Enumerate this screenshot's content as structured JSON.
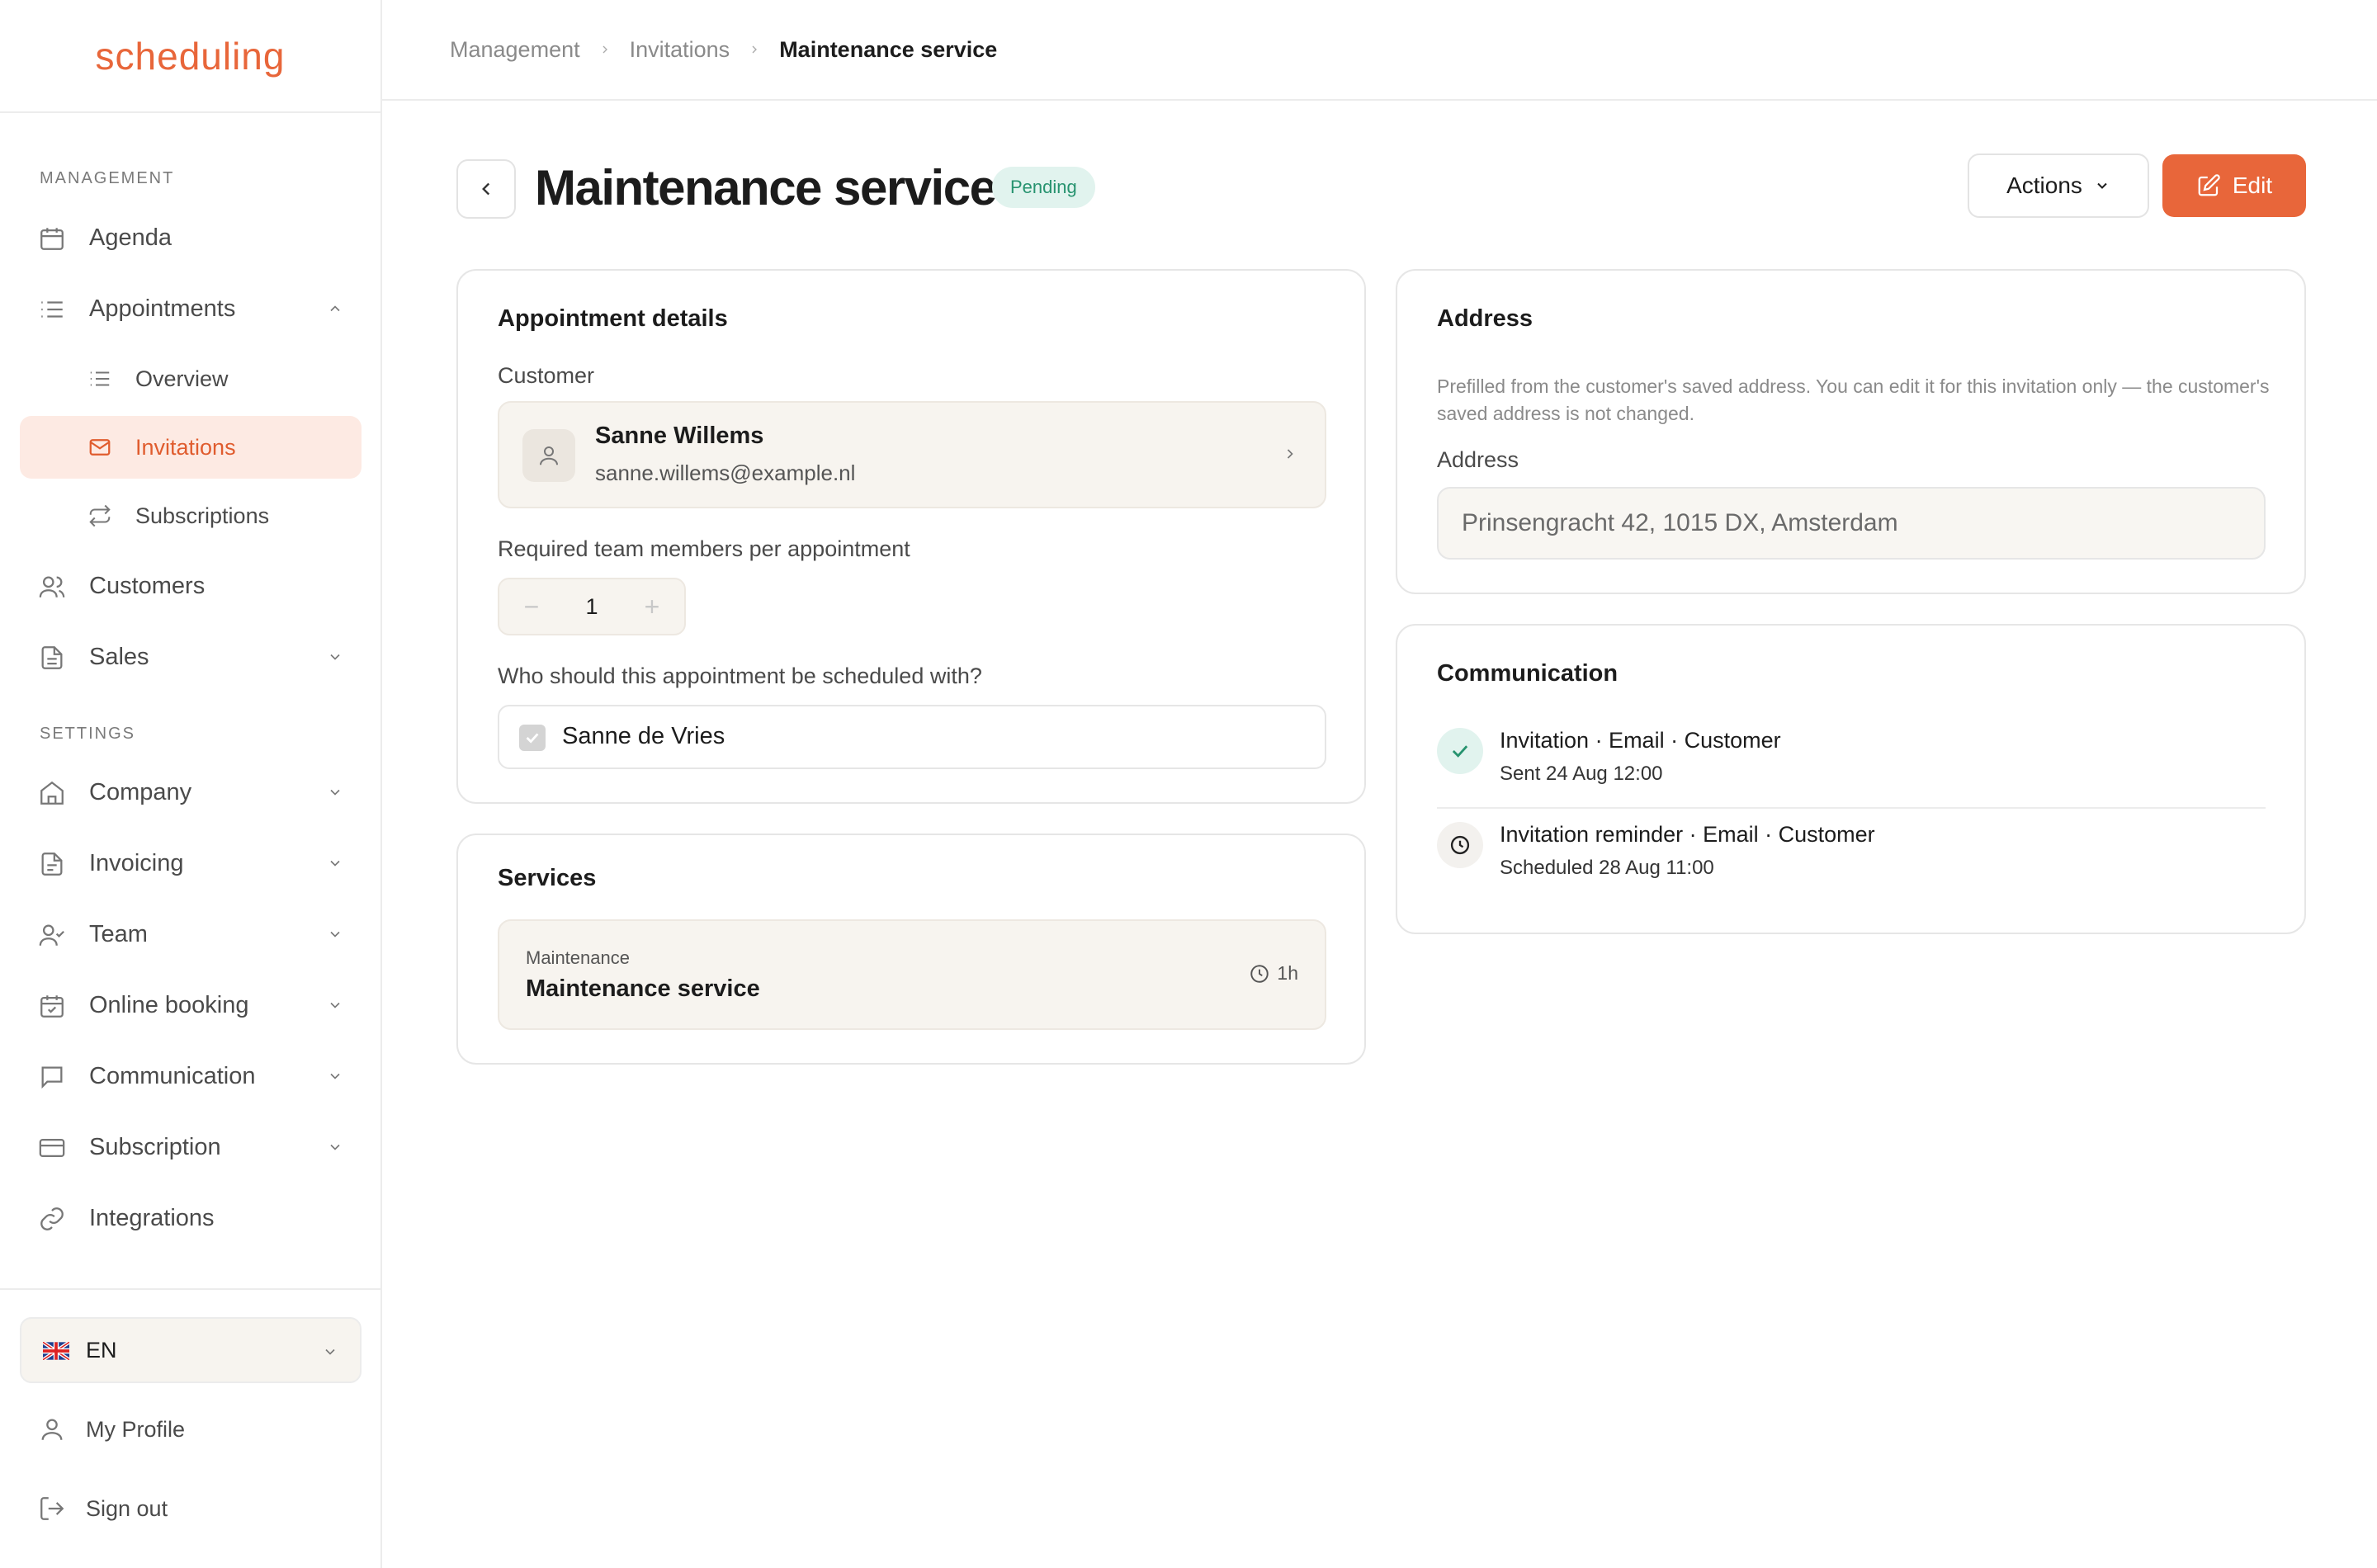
{
  "app": {
    "logo": "scheduling"
  },
  "sidebar": {
    "management_label": "MANAGEMENT",
    "settings_label": "SETTINGS",
    "items": {
      "agenda": "Agenda",
      "appointments": "Appointments",
      "overview": "Overview",
      "invitations": "Invitations",
      "subscriptions": "Subscriptions",
      "customers": "Customers",
      "sales": "Sales",
      "company": "Company",
      "invoicing": "Invoicing",
      "team": "Team",
      "online_booking": "Online booking",
      "communication": "Communication",
      "subscription": "Subscription",
      "integrations": "Integrations"
    },
    "language": "EN",
    "my_profile": "My Profile",
    "sign_out": "Sign out"
  },
  "breadcrumb": [
    "Management",
    "Invitations",
    "Maintenance service"
  ],
  "page": {
    "title": "Maintenance service",
    "status": "Pending",
    "actions_label": "Actions",
    "edit_label": "Edit"
  },
  "details": {
    "heading": "Appointment details",
    "customer_label": "Customer",
    "customer_name": "Sanne Willems",
    "customer_email": "sanne.willems@example.nl",
    "team_members_label": "Required team members per appointment",
    "team_members_value": "1",
    "scheduled_with_label": "Who should this appointment be scheduled with?",
    "member_name": "Sanne de Vries"
  },
  "services": {
    "heading": "Services",
    "category": "Maintenance",
    "name": "Maintenance service",
    "duration": "1h"
  },
  "address": {
    "heading": "Address",
    "help": "Prefilled from the customer's saved address. You can edit it for this invitation only — the customer's saved address is not changed.",
    "label": "Address",
    "value": "Prinsengracht 42, 1015 DX, Amsterdam"
  },
  "communication": {
    "heading": "Communication",
    "items": [
      {
        "title": "Invitation · Email · Customer",
        "subtitle": "Sent 24 Aug 12:00",
        "status": "sent"
      },
      {
        "title": "Invitation reminder · Email · Customer",
        "subtitle": "Scheduled 28 Aug 11:00",
        "status": "scheduled"
      }
    ]
  },
  "colors": {
    "accent": "#e8663a",
    "pending_bg": "#e1f3ee",
    "pending_text": "#27936f",
    "active_bg": "#fdeae3"
  }
}
